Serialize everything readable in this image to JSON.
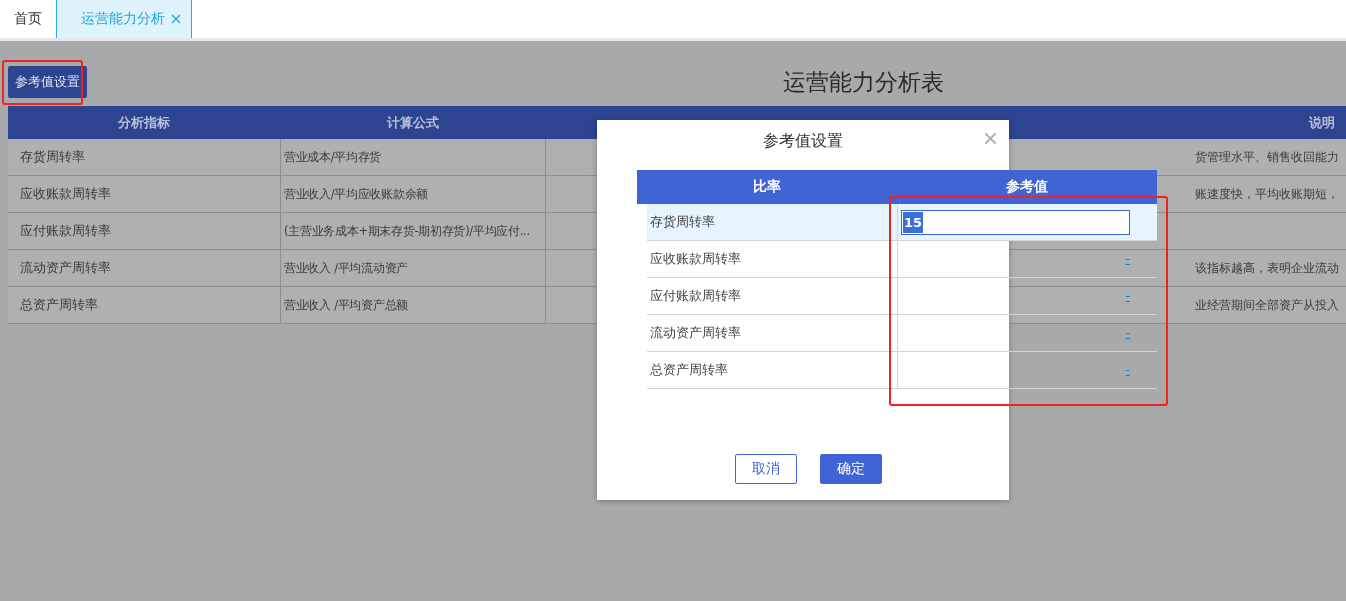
{
  "tabs": [
    {
      "label": "首页",
      "selected": false,
      "closable": false
    },
    {
      "label": "运营能力分析",
      "selected": true,
      "closable": true
    }
  ],
  "toolbar": {
    "button": "参考值设置",
    "highlighted": true
  },
  "report": {
    "title": "运营能力分析表",
    "columns": [
      "分析指标",
      "计算公式",
      null,
      null,
      "说明"
    ],
    "rows": [
      {
        "indicator": "存货周转率",
        "formula": "营业成本/平均存货",
        "note": "货管理水平、销售收回能力"
      },
      {
        "indicator": "应收账款周转率",
        "formula": "营业收入/平均应收账款余额",
        "note": "账速度快，平均收账期短，"
      },
      {
        "indicator": "应付账款周转率",
        "formula": "(主营业务成本+期末存货-期初存货)/平均应付..."
      },
      {
        "indicator": "流动资产周转率",
        "formula": "营业收入 /平均流动资产",
        "note": "该指标越高，表明企业流动"
      },
      {
        "indicator": "总资产周转率",
        "formula": "营业收入 /平均资产总额",
        "note": "业经营期间全部资产从投入"
      }
    ]
  },
  "dialog": {
    "title": "参考值设置",
    "columns": [
      "比率",
      "参考值"
    ],
    "value_column_highlighted": true,
    "rows": [
      {
        "name": "存货周转率",
        "kind": "input",
        "value": "15",
        "selected": true
      },
      {
        "name": "应收账款周转率",
        "kind": "link",
        "value": "-",
        "selected": false
      },
      {
        "name": "应付账款周转率",
        "kind": "link",
        "value": "-",
        "selected": false
      },
      {
        "name": "流动资产周转率",
        "kind": "link",
        "value": "-",
        "selected": false
      },
      {
        "name": "总资产周转率",
        "kind": "link",
        "value": "-",
        "selected": false
      }
    ],
    "buttons": [
      {
        "label": "取消",
        "kind": "secondary"
      },
      {
        "label": "确定",
        "kind": "primary"
      }
    ]
  }
}
